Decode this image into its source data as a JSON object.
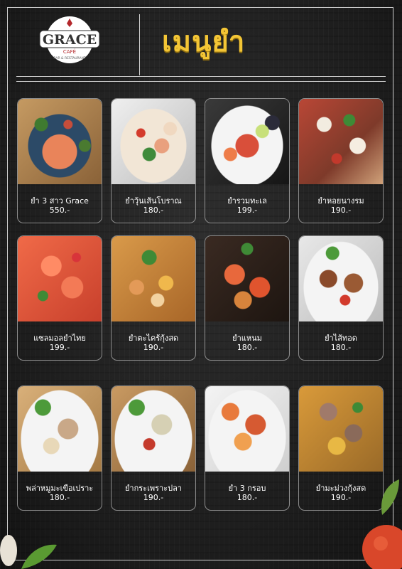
{
  "brand": {
    "name": "GRACE",
    "sub": "CAFÉ",
    "tagline": "BAR & RESTAURANT"
  },
  "title": "เมนูยำ",
  "items": [
    {
      "name": "ยำ 3 สาว Grace",
      "price": "550.-"
    },
    {
      "name": "ยำวุ้นเส้นโบราณ",
      "price": "180.-"
    },
    {
      "name": "ยำรวมทะเล",
      "price": "199.-"
    },
    {
      "name": "ยำหอยนางรม",
      "price": "190.-"
    },
    {
      "name": "แซลมอลยำไทย",
      "price": "199.-"
    },
    {
      "name": "ยำตะไคร้กุ้งสด",
      "price": "190.-"
    },
    {
      "name": "ยำแหนม",
      "price": "180.-"
    },
    {
      "name": "ยำไส้ทอด",
      "price": "180.-"
    },
    {
      "name": "พล่าหมูมะเขือเปราะ",
      "price": "180.-"
    },
    {
      "name": "ยำกระเพราะปลา",
      "price": "190.-"
    },
    {
      "name": "ยำ 3 กรอบ",
      "price": "180.-"
    },
    {
      "name": "ยำมะม่วงกุ้งสด",
      "price": "190.-"
    }
  ],
  "colors": {
    "title": "#f3c535",
    "background": "#1c1c1c",
    "text": "#ffffff"
  }
}
